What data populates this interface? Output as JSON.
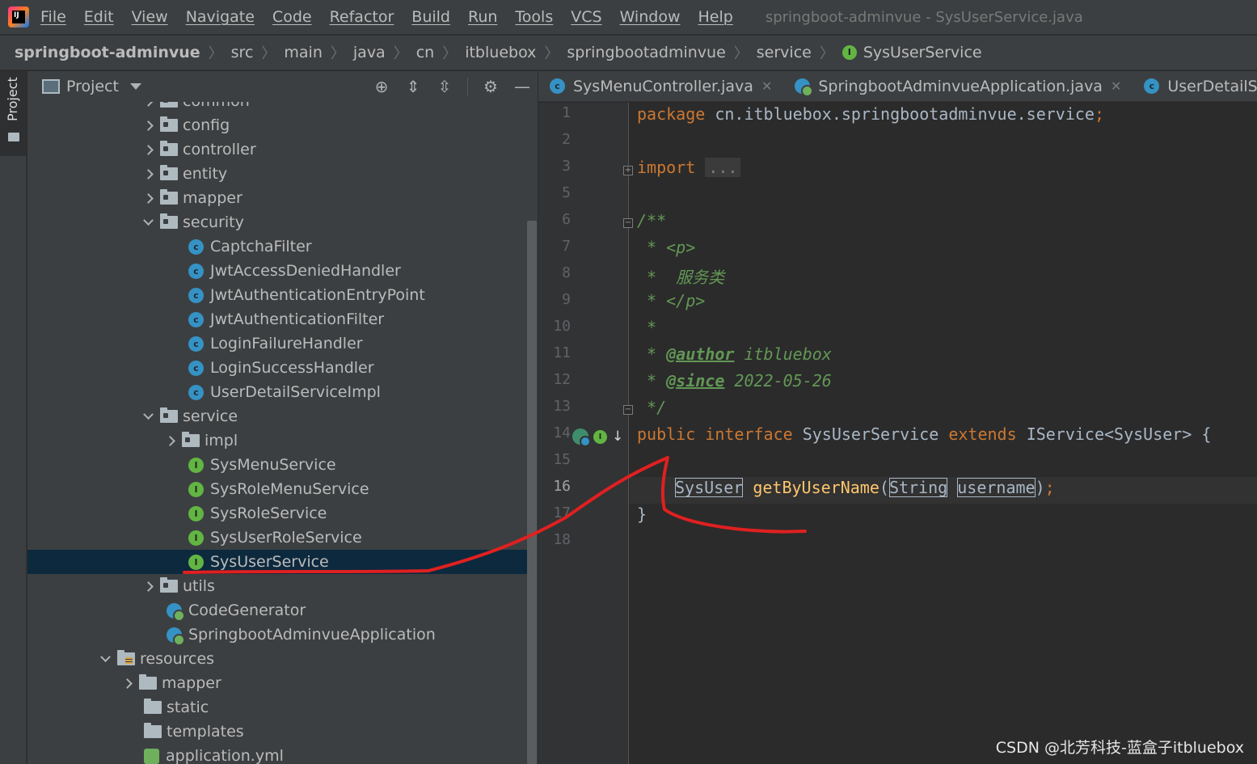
{
  "menubar": {
    "items": [
      "File",
      "Edit",
      "View",
      "Navigate",
      "Code",
      "Refactor",
      "Build",
      "Run",
      "Tools",
      "VCS",
      "Window",
      "Help"
    ],
    "window_title": "springboot-adminvue - SysUserService.java"
  },
  "breadcrumb": {
    "items": [
      "springboot-adminvue",
      "src",
      "main",
      "java",
      "cn",
      "itbluebox",
      "springbootadminvue",
      "service",
      "SysUserService"
    ]
  },
  "tool_stripe": {
    "project_label": "Project"
  },
  "project_panel": {
    "title": "Project",
    "tree": [
      {
        "label": "common",
        "kind": "folder",
        "chevron": "right"
      },
      {
        "label": "config",
        "kind": "folder",
        "chevron": "right"
      },
      {
        "label": "controller",
        "kind": "folder",
        "chevron": "right"
      },
      {
        "label": "entity",
        "kind": "folder",
        "chevron": "right"
      },
      {
        "label": "mapper",
        "kind": "folder",
        "chevron": "right"
      },
      {
        "label": "security",
        "kind": "folder",
        "chevron": "down"
      },
      {
        "label": "CaptchaFilter",
        "kind": "class"
      },
      {
        "label": "JwtAccessDeniedHandler",
        "kind": "class"
      },
      {
        "label": "JwtAuthenticationEntryPoint",
        "kind": "class"
      },
      {
        "label": "JwtAuthenticationFilter",
        "kind": "class"
      },
      {
        "label": "LoginFailureHandler",
        "kind": "class"
      },
      {
        "label": "LoginSuccessHandler",
        "kind": "class"
      },
      {
        "label": "UserDetailServiceImpl",
        "kind": "class"
      },
      {
        "label": "service",
        "kind": "folder",
        "chevron": "down"
      },
      {
        "label": "impl",
        "kind": "folder",
        "chevron": "right"
      },
      {
        "label": "SysMenuService",
        "kind": "interface"
      },
      {
        "label": "SysRoleMenuService",
        "kind": "interface"
      },
      {
        "label": "SysRoleService",
        "kind": "interface"
      },
      {
        "label": "SysUserRoleService",
        "kind": "interface"
      },
      {
        "label": "SysUserService",
        "kind": "interface",
        "selected": true
      },
      {
        "label": "utils",
        "kind": "folder",
        "chevron": "right"
      },
      {
        "label": "CodeGenerator",
        "kind": "app-class"
      },
      {
        "label": "SpringbootAdminvueApplication",
        "kind": "app-class"
      },
      {
        "label": "resources",
        "kind": "resource-folder",
        "chevron": "down"
      },
      {
        "label": "mapper",
        "kind": "folder",
        "chevron": "right"
      },
      {
        "label": "static",
        "kind": "folder"
      },
      {
        "label": "templates",
        "kind": "folder"
      },
      {
        "label": "application.yml",
        "kind": "yml"
      }
    ]
  },
  "editor": {
    "tabs": [
      {
        "label": "SysMenuController.java",
        "icon": "class-icon"
      },
      {
        "label": "SpringbootAdminvueApplication.java",
        "icon": "spring-app-icon"
      },
      {
        "label": "UserDetailServiceImpl",
        "icon": "class-icon"
      }
    ],
    "line_numbers": [
      "1",
      "2",
      "3",
      "5",
      "6",
      "7",
      "8",
      "9",
      "10",
      "11",
      "12",
      "13",
      "14",
      "15",
      "16",
      "17",
      "18"
    ],
    "active_line": "16",
    "code": {
      "l1_kw": "package",
      "l1_rest": " cn.itbluebox.springbootadminvue.service",
      "l1_semi": ";",
      "l3_kw": "import",
      "l3_fold": "...",
      "l6": "/**",
      "l7": " * <p>",
      "l8": " *  服务类",
      "l9": " * </p>",
      "l10": " *",
      "l11_star": " * ",
      "l11_tag": "@author",
      "l11_val": " itbluebox",
      "l12_star": " * ",
      "l12_tag": "@since",
      "l12_val": " 2022-05-26",
      "l13": " */",
      "l14_kw1": "public",
      "l14_kw2": "interface",
      "l14_name": "SysUserService",
      "l14_kw3": "extends",
      "l14_rest": "IService<SysUser> {",
      "l16_type": "SysUser",
      "l16_fn": "getByUserName",
      "l16_open": "(",
      "l16_ptype": "String",
      "l16_pname": "username",
      "l16_close": ")",
      "l16_semi": ";",
      "l17": "}"
    }
  },
  "watermark": "CSDN @北芳科技-蓝盒子itbluebox",
  "colors": {
    "annotation_stroke": "#e02020",
    "selection": "#0d293e",
    "keyword": "#cc7832",
    "comment": "#629755",
    "function": "#ffc66d"
  }
}
